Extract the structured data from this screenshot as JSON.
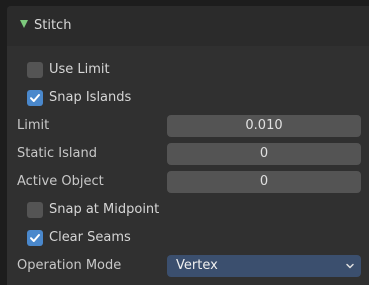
{
  "panel": {
    "title": "Stitch",
    "expanded": true,
    "header_arrow_color": "#7dca7d"
  },
  "options": {
    "use_limit": {
      "label": "Use Limit",
      "checked": false
    },
    "snap_islands": {
      "label": "Snap Islands",
      "checked": true
    },
    "snap_at_midpoint": {
      "label": "Snap at Midpoint",
      "checked": false
    },
    "clear_seams": {
      "label": "Clear Seams",
      "checked": true
    }
  },
  "properties": {
    "limit": {
      "label": "Limit",
      "value": "0.010"
    },
    "static_island": {
      "label": "Static Island",
      "value": "0"
    },
    "active_object": {
      "label": "Active Object",
      "value": "0"
    },
    "operation_mode": {
      "label": "Operation Mode",
      "value": "Vertex"
    }
  },
  "colors": {
    "checkbox_checked": "#4a88cc",
    "checkbox_unchecked": "#545454",
    "field_bg": "#545454",
    "dropdown_bg": "#3b4f6e",
    "panel_bg": "#303030"
  }
}
